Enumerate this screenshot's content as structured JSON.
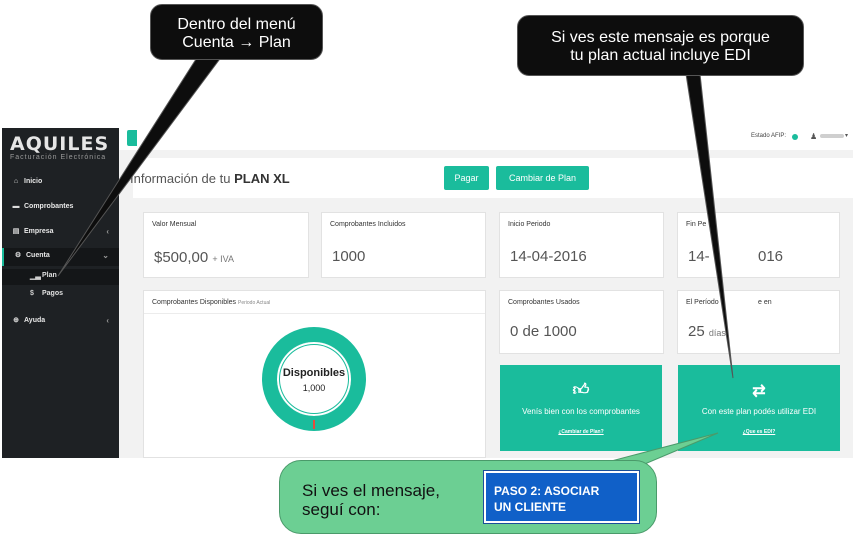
{
  "brand": {
    "name": "AQUILES",
    "tagline": "Facturación Electrónica"
  },
  "sidebar": {
    "items": [
      {
        "label": "Inicio",
        "icon": "home-icon"
      },
      {
        "label": "Comprobantes",
        "icon": "card-icon"
      },
      {
        "label": "Empresa",
        "icon": "building-icon"
      },
      {
        "label": "Cuenta",
        "icon": "gears-icon"
      },
      {
        "label": "Ayuda",
        "icon": "plus-circle-icon"
      }
    ],
    "subitems": [
      {
        "label": "Plan",
        "icon": "bar-chart-icon"
      },
      {
        "label": "Pagos",
        "icon": "dollar-icon"
      }
    ]
  },
  "topbar": {
    "estado_label": "Estado AFIP:",
    "estado_color": "#1abc9c"
  },
  "page": {
    "title_prefix": "Información de tu",
    "title_plan": "PLAN XL",
    "pay_button": "Pagar",
    "change_button": "Cambiar de Plan"
  },
  "cards": {
    "valor_mensual": {
      "title": "Valor Mensual",
      "value": "$500,00",
      "suffix": "+ IVA"
    },
    "comprobantes_incluidos": {
      "title": "Comprobantes Incluidos",
      "value": "1000"
    },
    "inicio_periodo": {
      "title": "Inicio Periodo",
      "value": "14-04-2016"
    },
    "fin_periodo": {
      "title": "Fin Pe",
      "value": "14-",
      "value_tail": "016"
    },
    "disponibles": {
      "title": "Comprobantes Disponibles",
      "subtitle": "Periodo Actual",
      "label": "Disponibles",
      "value": "1,000"
    },
    "usados": {
      "title": "Comprobantes Usados",
      "value": "0 de 1000"
    },
    "periodo": {
      "title": "El Período",
      "title_tail": "e en",
      "value": "25",
      "unit": "días"
    }
  },
  "tiles": {
    "plan_ok": {
      "text": "Venís bien con los comprobantes",
      "link": "¿Cambiar de Plan?",
      "icon": "thumbs-up-icon"
    },
    "edi": {
      "text": "Con este plan podés utilizar EDI",
      "link": "¿Que es EDI?",
      "icon": "exchange-icon"
    }
  },
  "callouts": {
    "menu": {
      "line1": "Dentro del menú",
      "line2": "Cuenta → Plan"
    },
    "edi": {
      "line1": "Si ves este mensaje es porque",
      "line2": "tu plan actual incluye EDI"
    },
    "next": {
      "line1": "Si ves el mensaje,",
      "line2": "seguí con:"
    },
    "step": {
      "line1": "PASO 2: ASOCIAR",
      "line2": "UN CLIENTE"
    }
  },
  "colors": {
    "accent": "#1abc9c",
    "sidebar": "#1e2124",
    "step_box": "#1060c8",
    "callout_green": "#6ccf93"
  }
}
